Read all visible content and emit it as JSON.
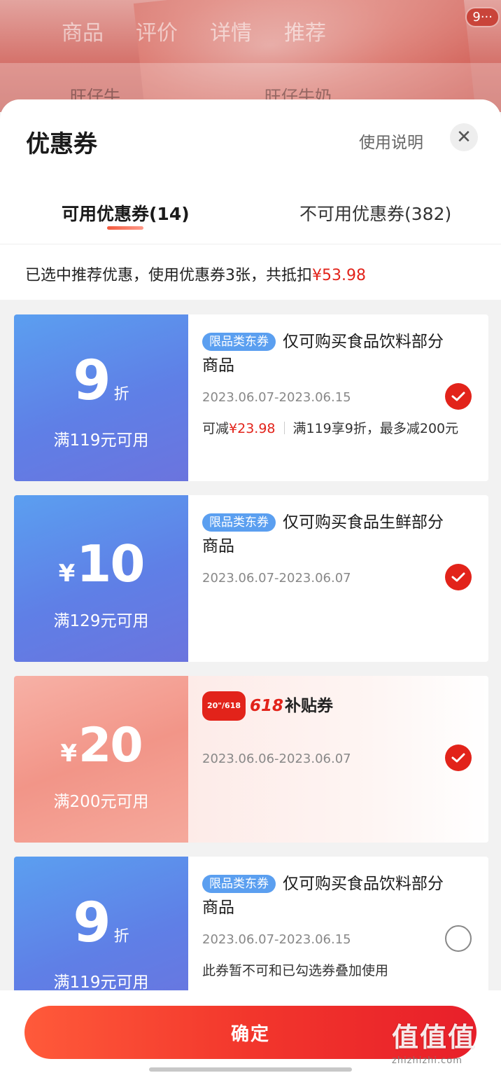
{
  "background_page": {
    "tabs": [
      "商品",
      "评价",
      "详情",
      "推荐"
    ],
    "badge": "9···",
    "brand_left": "旺仔牛",
    "brand_right": "旺仔牛奶"
  },
  "sheet": {
    "title": "优惠券",
    "usage_link": "使用说明",
    "close_symbol": "✕",
    "tabs": [
      {
        "label": "可用优惠券(14)",
        "active": true
      },
      {
        "label": "不可用优惠券(382)",
        "active": false
      }
    ]
  },
  "summary": {
    "text": "已选中推荐优惠，使用优惠券3张，共抵扣",
    "amount": "¥53.98"
  },
  "coupons": [
    {
      "value": "9",
      "unit": "折",
      "condition": "满119元可用",
      "tag": "限品类东券",
      "title": "仅可购买食品饮料部分商品",
      "date": "2023.06.07-2023.06.15",
      "detail_prefix": "可减",
      "detail_amount": "¥23.98",
      "detail_rule": "满119享9折，最多减200元",
      "checked": true
    },
    {
      "currency": "¥",
      "value": "10",
      "condition": "满129元可用",
      "tag": "限品类东券",
      "title": "仅可购买食品生鲜部分商品",
      "date": "2023.06.07-2023.06.07",
      "checked": true
    },
    {
      "currency": "¥",
      "value": "20",
      "condition": "满200元可用",
      "tag_pill": "20\"/618",
      "tag_num": "618",
      "tag_word": "补贴券",
      "date": "2023.06.06-2023.06.07",
      "checked": true
    },
    {
      "value": "9",
      "unit": "折",
      "condition": "满119元可用",
      "tag": "限品类东券",
      "title": "仅可购买食品饮料部分商品",
      "date": "2023.06.07-2023.06.15",
      "note": "此券暂不可和已勾选券叠加使用",
      "checked": false
    }
  ],
  "footer": {
    "confirm_label": "确定"
  },
  "watermark": {
    "big": "值值值",
    "small": "zhizhizhi.com"
  },
  "colors": {
    "accent_red": "#e2231a",
    "coupon_blue": "#5b9ff0",
    "coupon_pink": "#f29588"
  }
}
